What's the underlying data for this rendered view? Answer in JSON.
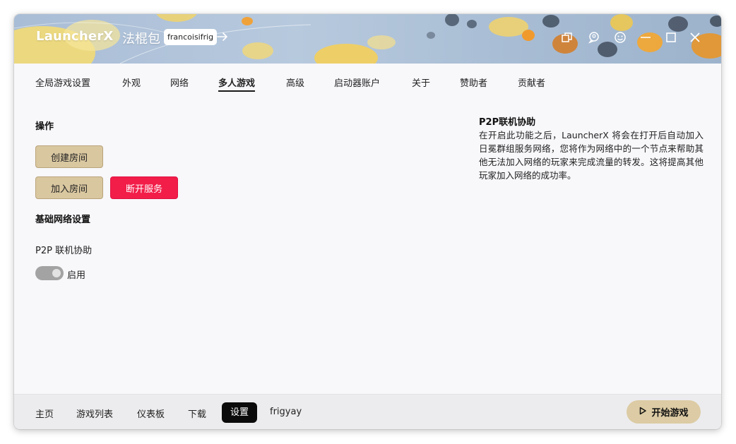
{
  "titlebar": {
    "app_name": "LauncherX",
    "profile_name": "法棍包",
    "user": "francoisifrig",
    "icons": [
      "switch-arrow-icon",
      "restore-window-icon",
      "chat-icon",
      "smiley-icon",
      "minimize-icon",
      "maximize-icon",
      "close-icon"
    ]
  },
  "tabs": [
    {
      "label": "全局游戏设置"
    },
    {
      "label": "外观"
    },
    {
      "label": "网络"
    },
    {
      "label": "多人游戏",
      "active": true
    },
    {
      "label": "高级"
    },
    {
      "label": "启动器账户"
    },
    {
      "label": "关于"
    },
    {
      "label": "赞助者"
    },
    {
      "label": "贡献者"
    }
  ],
  "operations": {
    "title": "操作",
    "create_room": "创建房间",
    "join_room": "加入房间",
    "disconnect": "断开服务"
  },
  "network_settings": {
    "title": "基础网络设置",
    "p2p_label": "P2P 联机协助",
    "toggle_label": "启用",
    "toggle_on": true
  },
  "info": {
    "title": "P2P联机协助",
    "text": "在开启此功能之后，LauncherX 将会在打开后自动加入日冕群组服务网络，您将作为网络中的一个节点来帮助其他无法加入网络的玩家来完成流量的转发。这将提高其他玩家加入网络的成功率。"
  },
  "bottom_nav": [
    {
      "label": "主页"
    },
    {
      "label": "游戏列表"
    },
    {
      "label": "仪表板"
    },
    {
      "label": "下载"
    },
    {
      "label": "设置",
      "active": true
    },
    {
      "label": "frigyay"
    }
  ],
  "start_button": {
    "label": "开始游戏",
    "icon": "play-icon"
  },
  "colors": {
    "accent_tan": "#d9c7a0",
    "danger_red": "#f21d49",
    "toggle_gray": "#a3a3a3",
    "active_nav": "#0b0b0b"
  }
}
